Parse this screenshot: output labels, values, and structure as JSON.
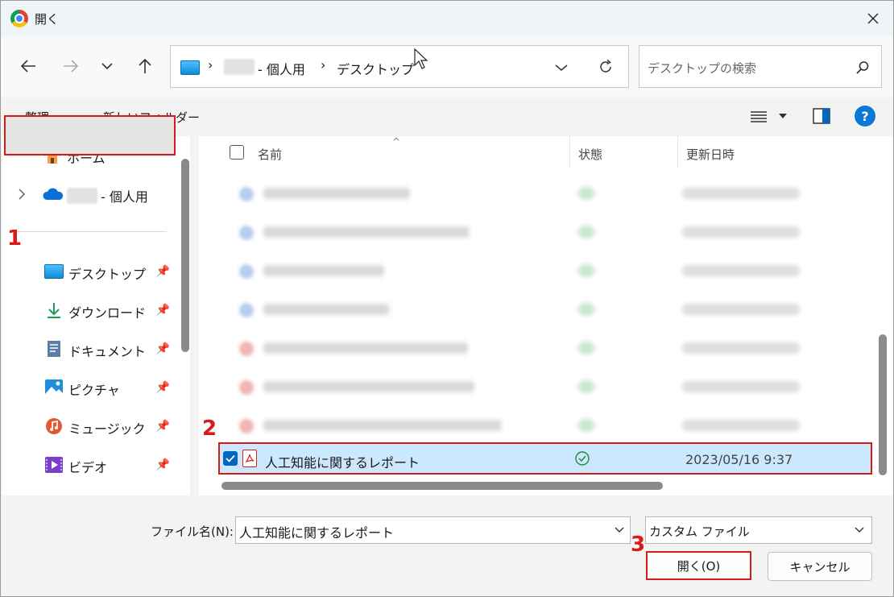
{
  "window": {
    "title": "開く",
    "close_icon": "close-icon"
  },
  "nav": {
    "back_icon": "arrow-left-icon",
    "forward_icon": "arrow-right-icon",
    "recent_icon": "chevron-down-icon",
    "up_icon": "arrow-up-icon",
    "address": {
      "separator": "›",
      "parts": [
        "- 個人用",
        "デスクトップ"
      ]
    },
    "search_placeholder": "デスクトップの検索"
  },
  "cmdbar": {
    "organize": "整理",
    "new_folder": "新しいフォルダー"
  },
  "sidebar": {
    "home": "ホーム",
    "onedrive_suffix": "- 個人用",
    "items": [
      {
        "label": "デスクトップ",
        "icon": "desktop-icon"
      },
      {
        "label": "ダウンロード",
        "icon": "download-icon"
      },
      {
        "label": "ドキュメント",
        "icon": "document-icon"
      },
      {
        "label": "ピクチャ",
        "icon": "pictures-icon"
      },
      {
        "label": "ミュージック",
        "icon": "music-icon"
      },
      {
        "label": "ビデオ",
        "icon": "video-icon"
      }
    ],
    "pin_glyph": "📌"
  },
  "filelist": {
    "columns": {
      "name": "名前",
      "status": "状態",
      "modified": "更新日時"
    },
    "selected_file": {
      "name": "人工知能に関するレポート",
      "modified": "2023/05/16 9:37"
    }
  },
  "bottom": {
    "filename_label": "ファイル名(N):",
    "filename_value": "人工知能に関するレポート",
    "filetype_value": "カスタム ファイル",
    "open_button": "開く(O)",
    "cancel_button": "キャンセル"
  },
  "annotations": {
    "marker_1": "1",
    "marker_2": "2",
    "marker_3": "3"
  },
  "colors": {
    "accent": "#0067c0",
    "highlight": "#d71a1a",
    "selection": "#cce8ff"
  }
}
